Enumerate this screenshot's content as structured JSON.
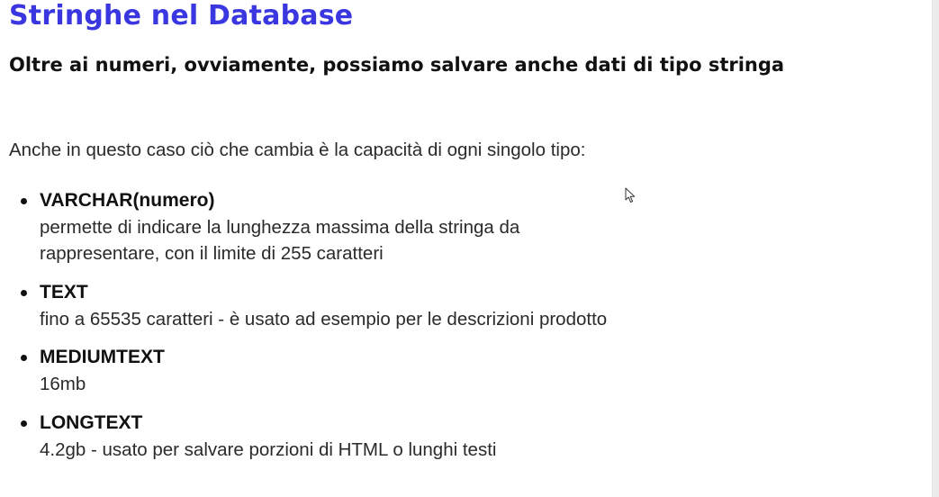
{
  "colors": {
    "title": "#3b37e0",
    "text": "#2a2a2a",
    "heading": "#111111",
    "background": "#ffffff"
  },
  "title": "Stringhe nel Database",
  "subtitle": "Oltre ai numeri, ovviamente, possiamo salvare anche dati di tipo stringa",
  "intro": "Anche in questo caso ciò che cambia è la capacità di ogni singolo tipo:",
  "types": [
    {
      "name": "VARCHAR(numero)",
      "description": "permette di indicare la lunghezza massima della stringa da\nrappresentare, con il limite di 255 caratteri"
    },
    {
      "name": "TEXT",
      "description": "fino a 65535 caratteri - è usato ad esempio per le descrizioni prodotto"
    },
    {
      "name": "MEDIUMTEXT",
      "description": "16mb"
    },
    {
      "name": "LONGTEXT",
      "description": "4.2gb - usato per salvare porzioni di HTML o lunghi testi"
    }
  ],
  "cursor_icon": "mouse-pointer-icon"
}
